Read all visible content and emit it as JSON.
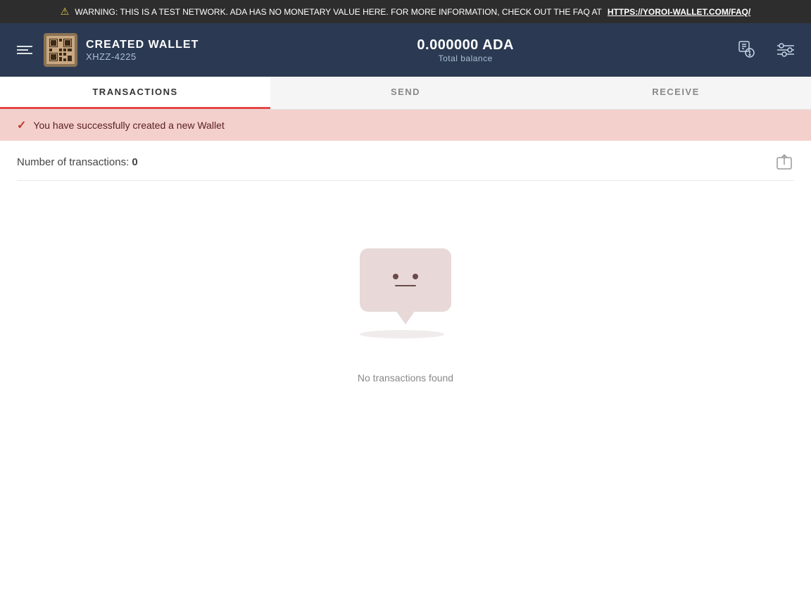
{
  "warning": {
    "text": "WARNING: THIS IS A TEST NETWORK. ADA HAS NO MONETARY VALUE HERE. FOR MORE INFORMATION, CHECK OUT THE FAQ AT ",
    "link_text": "HTTPS://YOROI-WALLET.COM/FAQ/",
    "link_url": "https://yoroi-wallet.com/faq/"
  },
  "header": {
    "wallet_name": "CREATED WALLET",
    "wallet_id": "XHZZ-4225",
    "balance_amount": "0.000000 ADA",
    "balance_label": "Total balance"
  },
  "tabs": [
    {
      "label": "TRANSACTIONS",
      "active": true
    },
    {
      "label": "SEND",
      "active": false
    },
    {
      "label": "RECEIVE",
      "active": false
    }
  ],
  "success_banner": {
    "message": "You have successfully created a new Wallet"
  },
  "transactions": {
    "count_label": "Number of transactions:",
    "count": "0",
    "empty_text": "No transactions found"
  },
  "icons": {
    "warning": "⚠",
    "check": "✓",
    "sidebar_toggle": "menu",
    "notification": "notification-icon",
    "filter": "filter-icon",
    "export": "export-icon"
  }
}
